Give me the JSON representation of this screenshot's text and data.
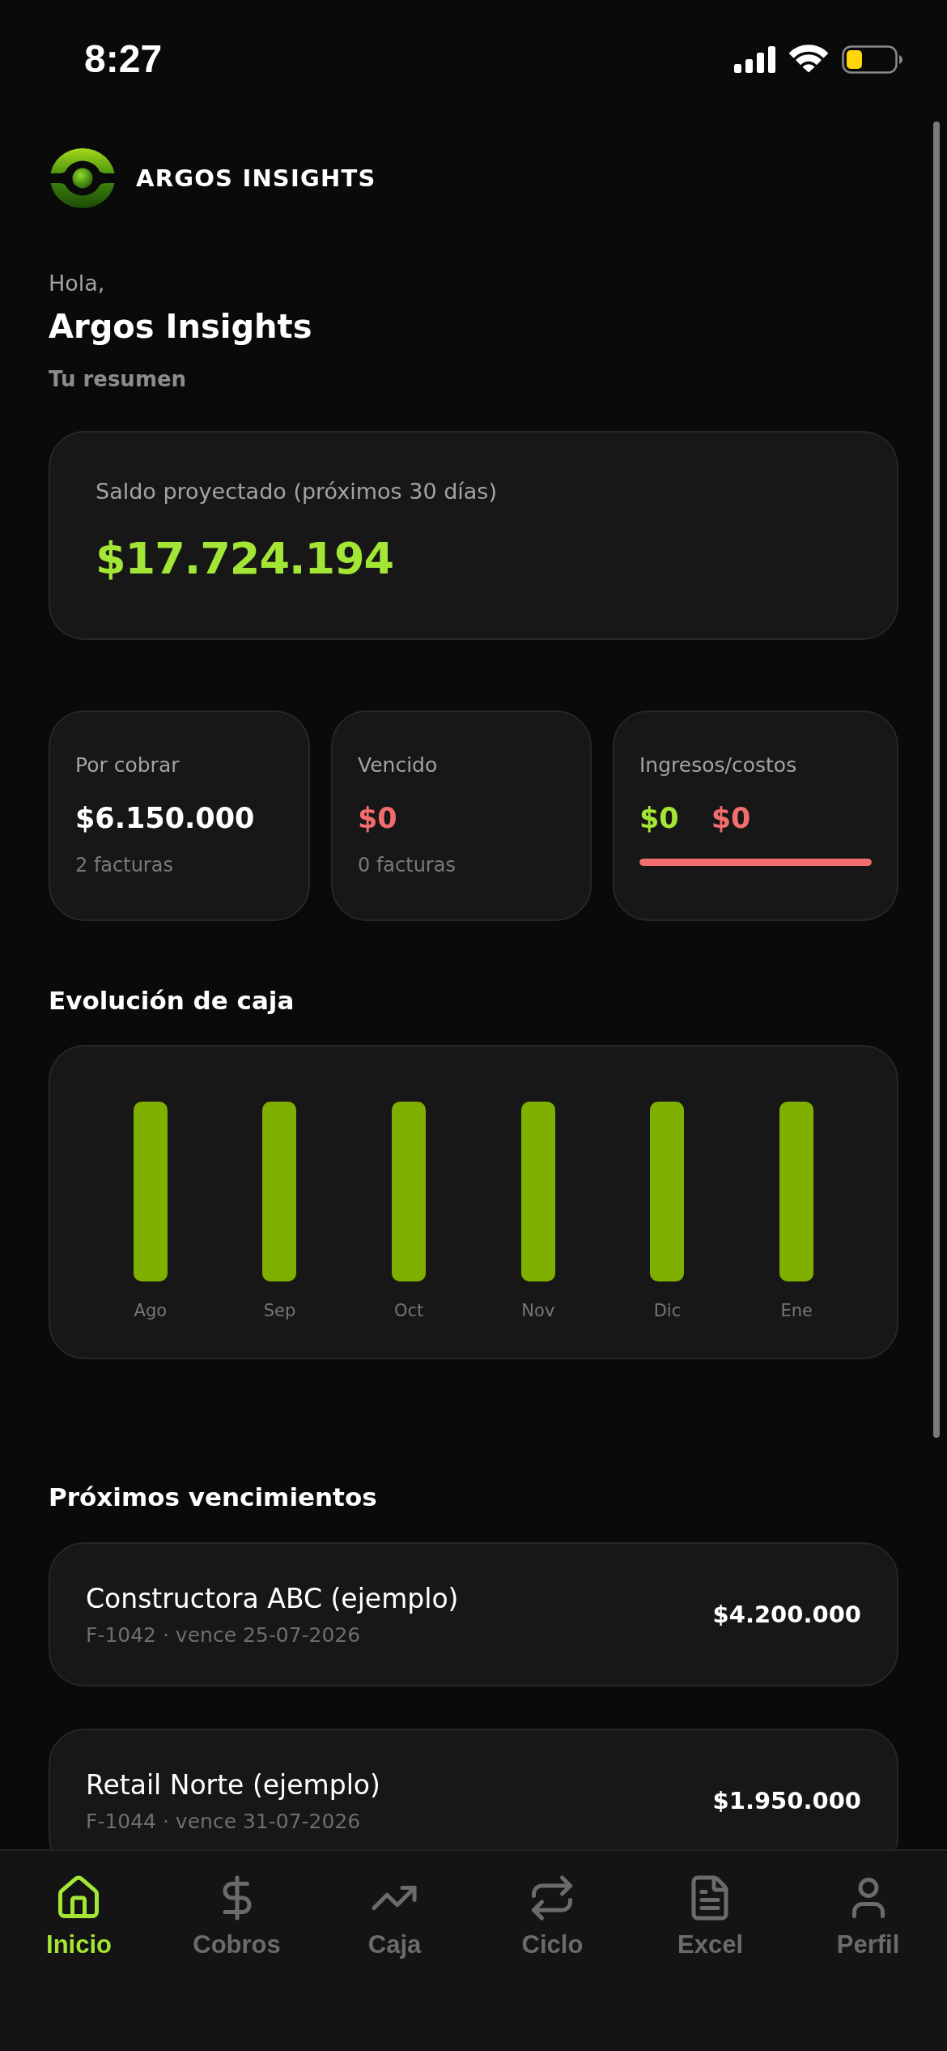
{
  "status_bar": {
    "time": "8:27"
  },
  "header": {
    "app_name": "ARGOS INSIGHTS"
  },
  "greeting": {
    "salutation": "Hola,",
    "name": "Argos Insights",
    "subtitle": "Tu resumen"
  },
  "balance_card": {
    "label": "Saldo proyectado (próximos 30 días)",
    "value": "$17.724.194"
  },
  "stats": [
    {
      "kind": "count",
      "label": "Por cobrar",
      "value": "$6.150.000",
      "color": "#ffffff",
      "note": "2 facturas"
    },
    {
      "kind": "count",
      "label": "Vencido",
      "value": "$0",
      "color": "#f26d6d",
      "note": "0 facturas"
    },
    {
      "kind": "split",
      "label": "Ingresos/costos",
      "amounts": [
        {
          "value": "$0",
          "color": "#a3e635"
        },
        {
          "value": "$0",
          "color": "#f26d6d"
        }
      ],
      "level": 1
    }
  ],
  "cash_flow": {
    "title": "Evolución de caja",
    "months": [
      "Ago",
      "Sep",
      "Oct",
      "Nov",
      "Dic",
      "Ene"
    ]
  },
  "upcoming": {
    "title": "Próximos vencimientos",
    "items": [
      {
        "client": "Constructora ABC (ejemplo)",
        "detail": "F-1042 · vence 25-07-2026",
        "amount": "$4.200.000"
      },
      {
        "client": "Retail Norte (ejemplo)",
        "detail": "F-1044 · vence 31-07-2026",
        "amount": "$1.950.000"
      }
    ]
  },
  "tabs": [
    {
      "label": "Inicio",
      "selected": true
    },
    {
      "label": "Cobros",
      "selected": false
    },
    {
      "label": "Caja",
      "selected": false
    },
    {
      "label": "Ciclo",
      "selected": false
    },
    {
      "label": "Excel",
      "selected": false
    },
    {
      "label": "Perfil",
      "selected": false
    }
  ]
}
